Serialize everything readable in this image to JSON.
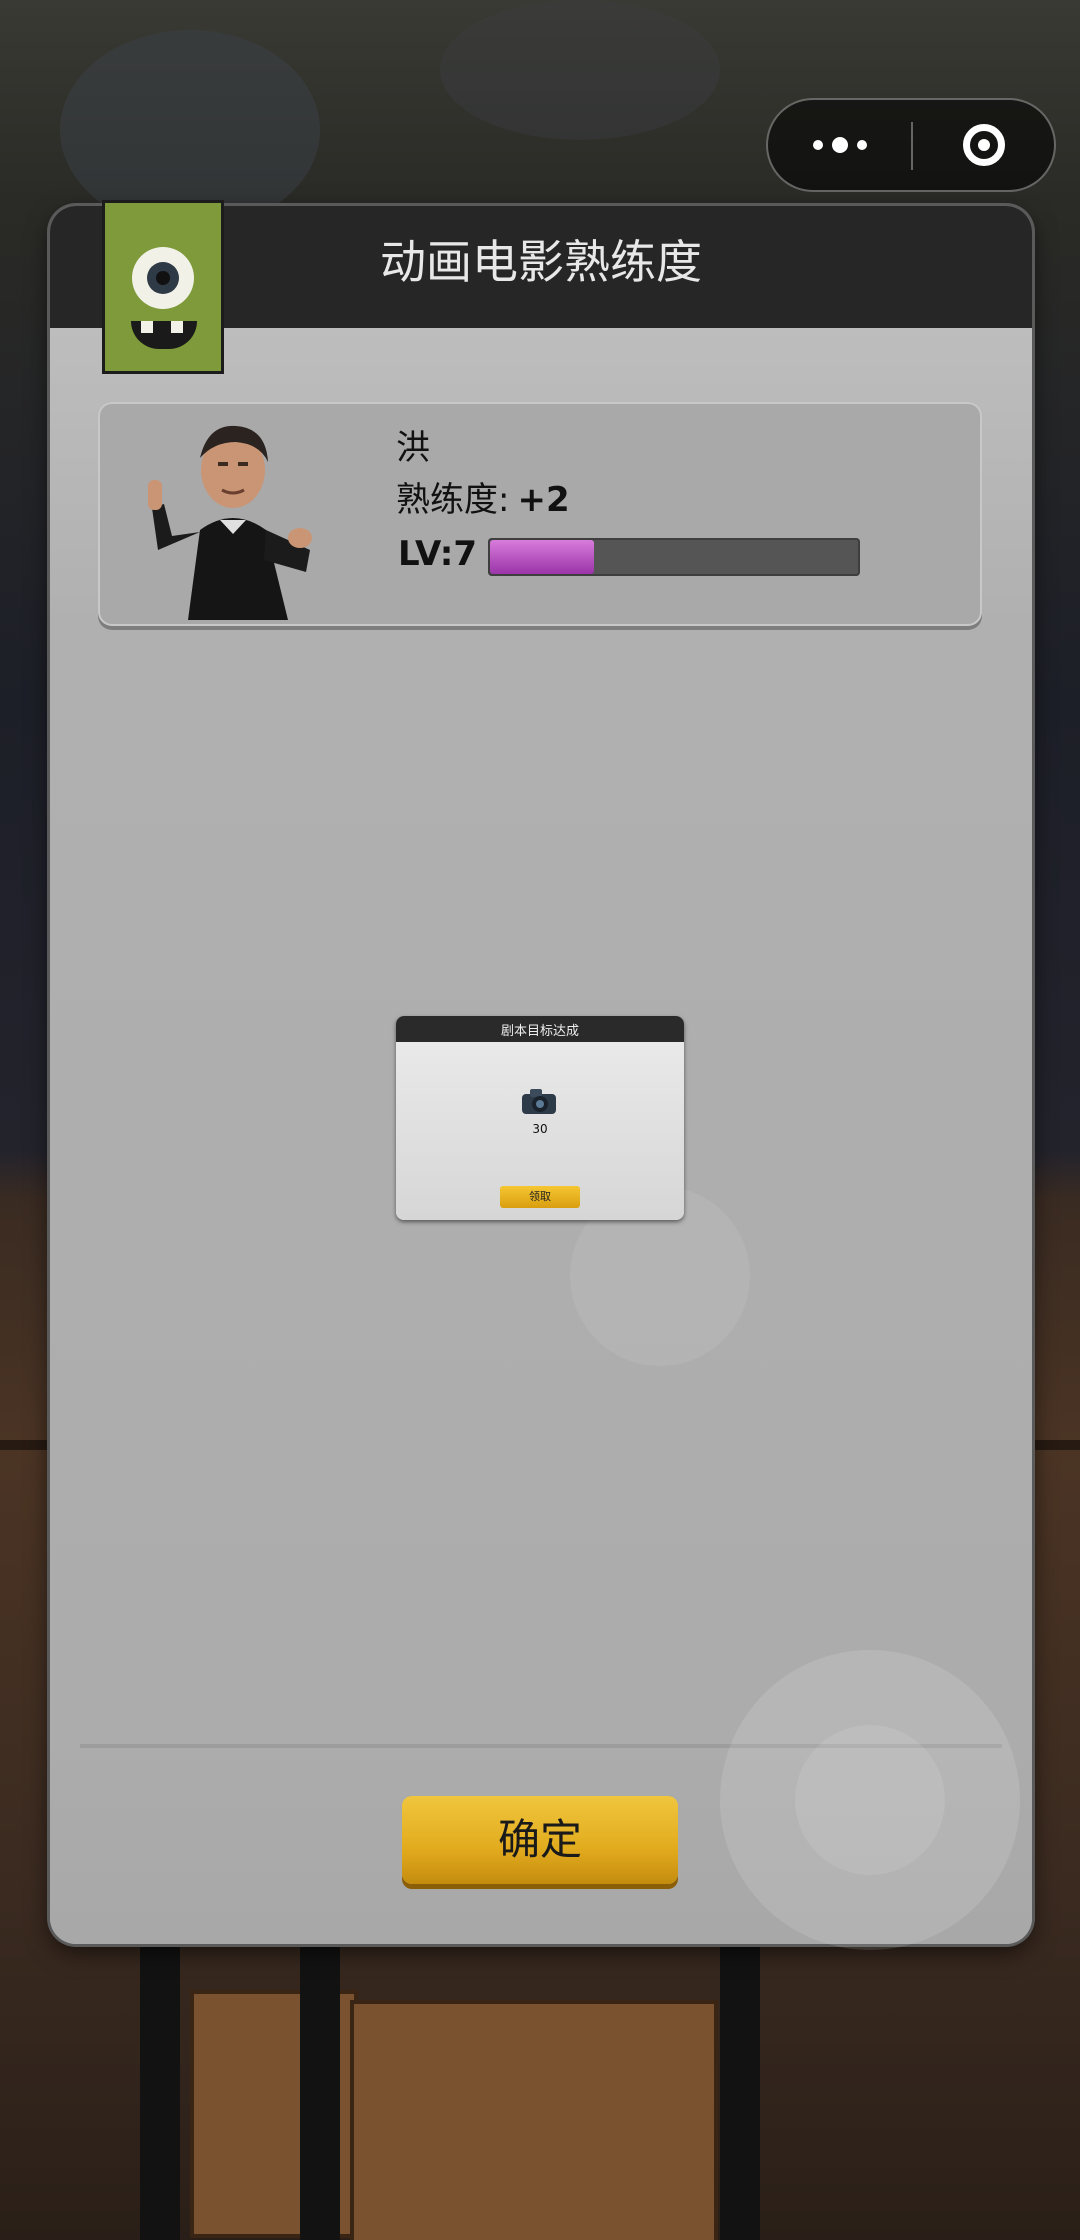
{
  "modal": {
    "title": "动画电影熟练度"
  },
  "character": {
    "name": "洪",
    "proficiency_label": "熟练度:",
    "proficiency_value": "+2",
    "level_label": "LV:7",
    "level_progress_fraction": 0.28
  },
  "mini_popup": {
    "title": "剧本目标达成",
    "reward_icon": "camera-icon",
    "reward_count": "30",
    "claim_label": "领取"
  },
  "actions": {
    "confirm_label": "确定"
  },
  "capsule": {
    "more_icon": "more-dots-icon",
    "close_icon": "close-target-icon"
  },
  "colors": {
    "header": "#262626",
    "panel": "#b1b1b1",
    "progress_fill": "#b04abf",
    "button_gold": "#e6b125",
    "badge_green": "#7e9a3a"
  }
}
